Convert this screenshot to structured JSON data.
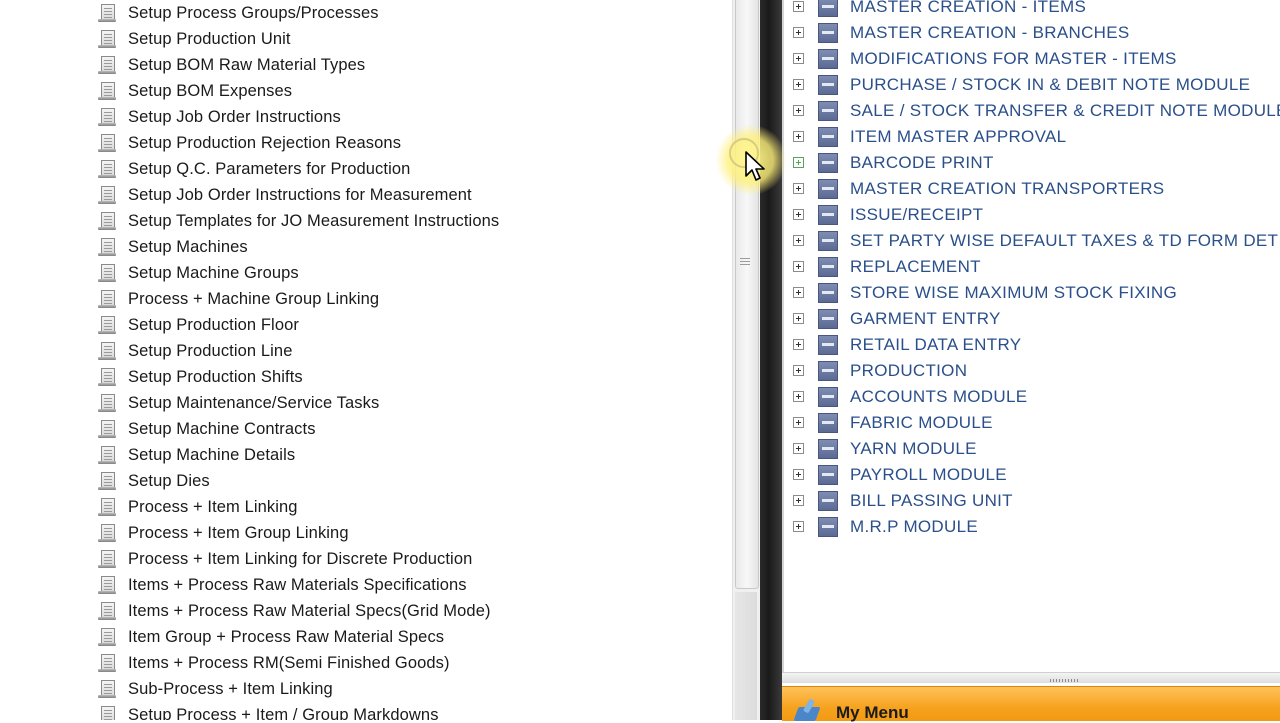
{
  "left_panel": {
    "items": [
      {
        "label": "Setup Process Groups/Processes"
      },
      {
        "label": "Setup Production Unit"
      },
      {
        "label": "Setup BOM Raw Material Types"
      },
      {
        "label": "Setup BOM Expenses"
      },
      {
        "label": "Setup Job Order Instructions"
      },
      {
        "label": "Setup Production Rejection Reasons"
      },
      {
        "label": "Setup Q.C. Parameters for Production"
      },
      {
        "label": "Setup Job Order Instructions for Measurement"
      },
      {
        "label": "Setup Templates for JO Measurement Instructions"
      },
      {
        "label": "Setup Machines"
      },
      {
        "label": "Setup Machine Groups"
      },
      {
        "label": "Process + Machine Group Linking"
      },
      {
        "label": "Setup Production Floor"
      },
      {
        "label": "Setup Production Line"
      },
      {
        "label": "Setup Production Shifts"
      },
      {
        "label": "Setup Maintenance/Service Tasks"
      },
      {
        "label": "Setup Machine Contracts"
      },
      {
        "label": "Setup Machine Details"
      },
      {
        "label": "Setup Dies"
      },
      {
        "label": "Process + Item Linking"
      },
      {
        "label": "Process + Item Group Linking"
      },
      {
        "label": "Process + Item Linking for Discrete Production"
      },
      {
        "label": "Items + Process  Raw Materials Specifications"
      },
      {
        "label": "Items + Process Raw Material Specs(Grid Mode)"
      },
      {
        "label": "Item Group + Process Raw Material Specs"
      },
      {
        "label": "Items + Process RM(Semi Finished Goods)"
      },
      {
        "label": "Sub-Process + Item Linking"
      },
      {
        "label": "Setup Process + Item / Group Markdowns"
      }
    ]
  },
  "right_panel": {
    "items": [
      {
        "label": "MASTER CREATION - ITEMS"
      },
      {
        "label": "MASTER CREATION - BRANCHES"
      },
      {
        "label": "MODIFICATIONS FOR MASTER - ITEMS"
      },
      {
        "label": "PURCHASE / STOCK IN & DEBIT NOTE MODULE"
      },
      {
        "label": "SALE / STOCK TRANSFER & CREDIT NOTE MODULE"
      },
      {
        "label": "ITEM MASTER APPROVAL"
      },
      {
        "label": "BARCODE PRINT"
      },
      {
        "label": "MASTER CREATION TRANSPORTERS"
      },
      {
        "label": "ISSUE/RECEIPT"
      },
      {
        "label": "SET PARTY WISE DEFAULT TAXES & TD FORM DET"
      },
      {
        "label": "REPLACEMENT"
      },
      {
        "label": "STORE WISE MAXIMUM STOCK FIXING"
      },
      {
        "label": "GARMENT ENTRY"
      },
      {
        "label": "RETAIL DATA ENTRY"
      },
      {
        "label": "PRODUCTION"
      },
      {
        "label": "ACCOUNTS MODULE"
      },
      {
        "label": "FABRIC MODULE"
      },
      {
        "label": "YARN MODULE"
      },
      {
        "label": "PAYROLL MODULE"
      },
      {
        "label": "BILL PASSING UNIT"
      },
      {
        "label": "M.R.P MODULE"
      }
    ]
  },
  "menu_bar": {
    "title": "My Menu"
  },
  "colors": {
    "right_label": "#2a4f8a",
    "menu_bar": "#f6a21f",
    "folder_icon": "#5a6a93"
  }
}
